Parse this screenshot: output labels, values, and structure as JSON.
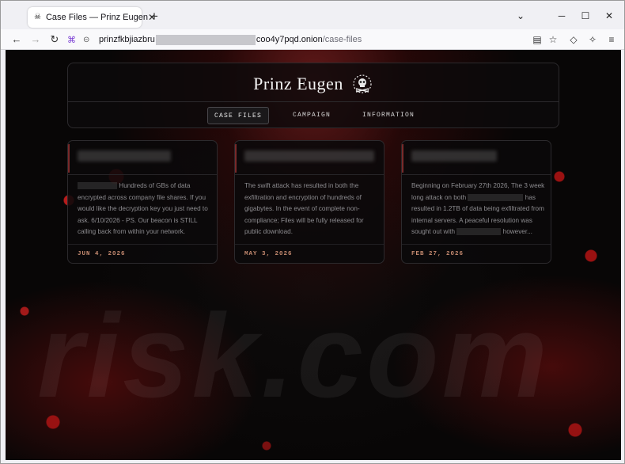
{
  "browser": {
    "tab_title": "Case Files — Prinz Eugen",
    "url_host_start": "prinzfkbjiazbru",
    "url_host_end": "coo4y7pqd.onion",
    "url_path": "/case-files"
  },
  "site": {
    "brand": "Prinz Eugen",
    "menu": [
      "CASE FILES",
      "CAMPAIGN",
      "INFORMATION"
    ],
    "active_menu": "CASE FILES"
  },
  "cards": [
    {
      "body_parts": [
        "Hundreds of GBs of data encrypted across company file shares. If you would like the decryption key you just need to ask. 6/10/2026 - PS. Our beacon is STILL calling back from within your network."
      ],
      "date": "JUN 4, 2026"
    },
    {
      "body_parts": [
        "The swift attack has resulted in both the exfiltration and encryption of hundreds of gigabytes. In the event of complete non-compliance; Files will be fully released for public download."
      ],
      "date": "MAY 3, 2026"
    },
    {
      "body_parts": [
        "Beginning on February 27th 2026, The 3 week long attack on both",
        "has resulted in 1.2TB of data being exfiltrated from internal servers. A peaceful resolution was sought out with",
        "however..."
      ],
      "date": "FEB 27, 2026"
    }
  ],
  "watermark": "risk.com",
  "colors": {
    "accent_date": "#c58a70",
    "card_accent": "#7a2a2a",
    "page_bg": "#070505"
  }
}
